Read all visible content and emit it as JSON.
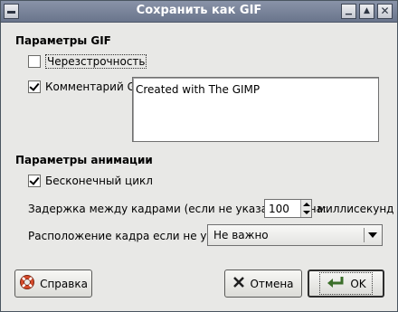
{
  "window": {
    "title": "Сохранить как GIF"
  },
  "gif_options": {
    "heading": "Параметры GIF",
    "interlace_label": "Черезстрочность",
    "interlace_checked": false,
    "comment_label": "Комментарий GIF:",
    "comment_checked": true,
    "comment_text": "Created with The GIMP"
  },
  "animation": {
    "heading": "Параметры анимации",
    "loop_label": "Бесконечный цикл",
    "loop_checked": true,
    "delay_label": "Задержка между кадрами (если не указана) равна:",
    "delay_value": "100",
    "delay_unit": "миллисекунд",
    "disposal_label": "Расположение кадра если не указано:",
    "disposal_value": "Не важно"
  },
  "buttons": {
    "help": "Справка",
    "cancel": "Отмена",
    "ok": "OK"
  },
  "icons": {
    "help": "lifebuoy-icon",
    "cancel": "x-icon",
    "ok": "checkmark-arrow-icon"
  }
}
